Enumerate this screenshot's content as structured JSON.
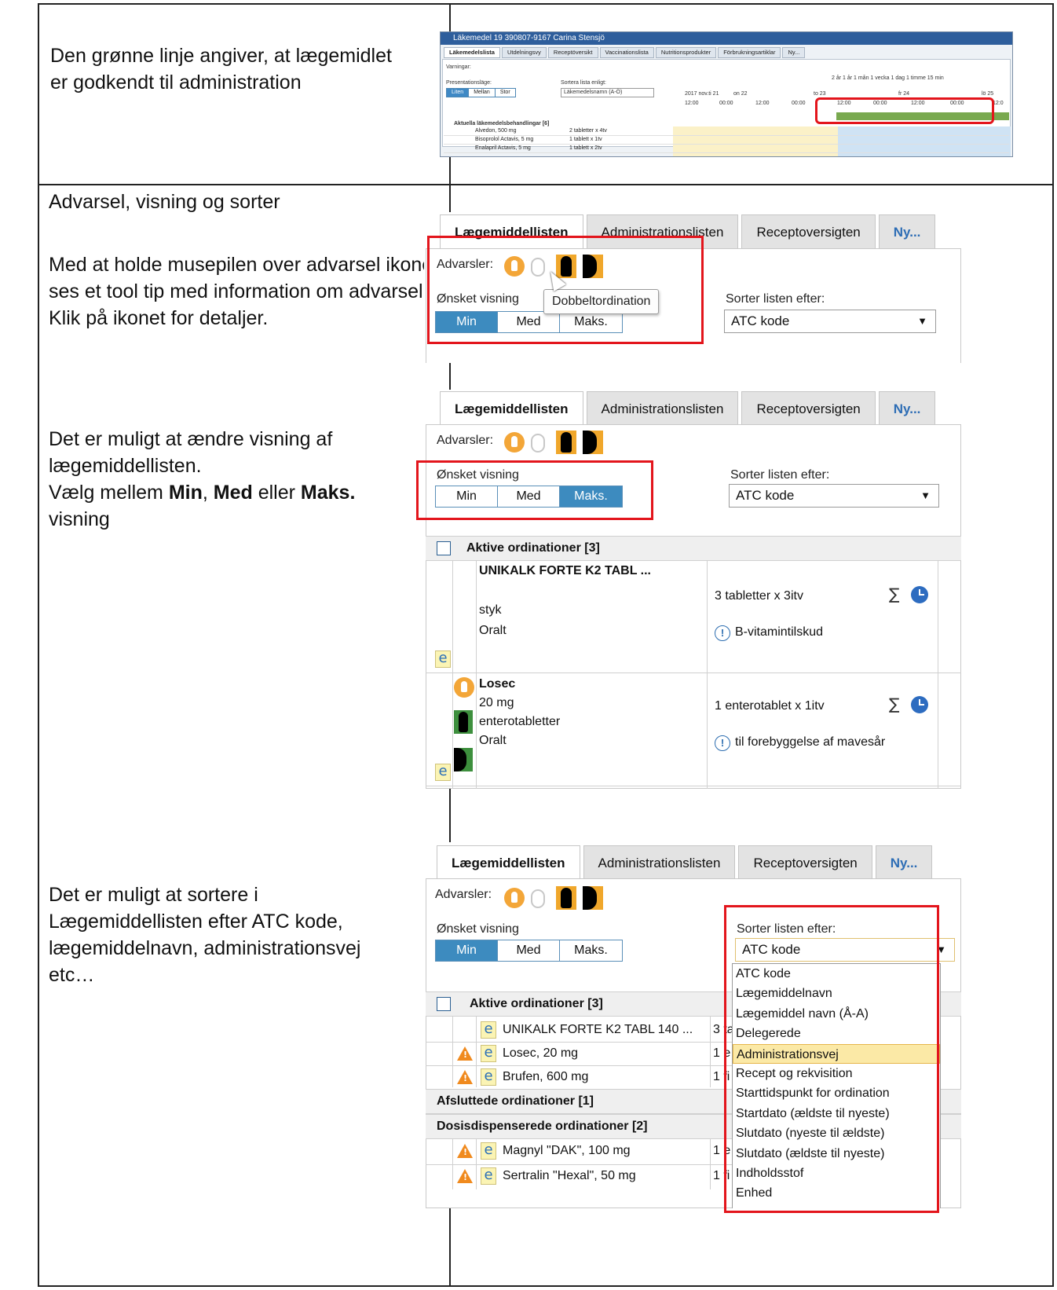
{
  "rows": [
    {
      "text": "Den grønne linje angiver, at lægemidlet er godkendt til administration"
    },
    {
      "heading": "Advarsel, visning og sorter",
      "text": "Med at holde musepilen over advarsel ikonet ses et tool tip med information om advarsel. Klik på ikonet for detaljer."
    },
    {
      "text_1": "Det er muligt at ændre visning af lægemiddellisten.",
      "text_2_pre": "Vælg mellem ",
      "opt_min": "Min",
      "sep1": ", ",
      "opt_med": "Med",
      "sep2": " eller ",
      "opt_maks": "Maks.",
      "text_2_post": "visning"
    },
    {
      "text": "Det er muligt at sortere i Lægemiddellisten efter ATC kode, lægemiddelnavn, administrationsvej etc…"
    }
  ],
  "overview": {
    "title": "Läkemedel 19 390807-9167 Carina Stensjö",
    "tabs": [
      "Läkemedelslista",
      "Utdelningsvy",
      "Receptöversikt",
      "Vaccinationslista",
      "Nutritionsprodukter",
      "Förbrukningsartiklar",
      "Ny..."
    ],
    "warnings_label": "Varningar:",
    "presentation_label": "Presentationsläge:",
    "presentation_options": [
      "Liten",
      "Mellan",
      "Stor"
    ],
    "sort_label": "Sortera lista enligt:",
    "sort_value": "Läkemedelsnamn (A-Ö)",
    "zoom_labels": "2 år   1 år   1 mån  1 vecka  1 dag  1 timme  15 min",
    "dates": [
      "2017 nov.ti 21",
      "on 22",
      "to 23",
      "fr 24",
      "lö 25"
    ],
    "times": [
      "12:00",
      "00:00",
      "12:00",
      "00:00",
      "12:00",
      "00:00",
      "12:00",
      "00:00",
      "12:0"
    ],
    "group": "Aktuella läkemedelsbehandlingar [6]",
    "rows": [
      {
        "name": "Alvedon, 500 mg",
        "dose": "2 tabletter x 4tv"
      },
      {
        "name": "Bisoprolol Actavis, 5 mg",
        "dose": "1 tablett x 1tv"
      },
      {
        "name": "Enalapril Actavis, 5 mg",
        "dose": "1 tablett x 2tv"
      }
    ]
  },
  "tabs": [
    "Lægemiddellisten",
    "Administrationslisten",
    "Receptoversigten",
    "Ny..."
  ],
  "warnings_label": "Advarsler:",
  "view_label": "Ønsket visning",
  "view_options": [
    "Min",
    "Med",
    "Maks."
  ],
  "view_options_s2": [
    "Min",
    "Med",
    "Maks."
  ],
  "sort_label": "Sorter listen efter:",
  "sort_value": "ATC kode",
  "tooltip": "Dobbeltordination",
  "s3": {
    "group": "Aktive ordinationer [3]",
    "items": [
      {
        "name": "UNIKALK FORTE K2 TABL ...",
        "unit": "styk",
        "route": "Oralt",
        "dose": "3 tabletter x 3itv",
        "note": "B-vitamintilskud"
      },
      {
        "name": "Losec",
        "strength": "20 mg",
        "form": "enterotabletter",
        "route": "Oralt",
        "dose": "1 enterotablet x 1itv",
        "note": "til forebyggelse af mavesår"
      }
    ]
  },
  "s4": {
    "group_active": "Aktive ordinationer [3]",
    "active_items": [
      "UNIKALK FORTE K2 TABL 140 ...",
      "Losec, 20 mg",
      "Brufen, 600 mg"
    ],
    "active_dose_frag": [
      "3 ta",
      "1 e",
      "1 fi"
    ],
    "group_finished": "Afsluttede ordinationer [1]",
    "group_dosis": "Dosisdispenserede ordinationer [2]",
    "dosis_items": [
      "Magnyl \"DAK\", 100 mg",
      "Sertralin \"Hexal\", 50 mg"
    ],
    "dosis_dose_frag": [
      "1 e",
      "1 fi"
    ],
    "menu": [
      "ATC kode",
      "Lægemiddelnavn",
      "Lægemiddel navn (Å-A)",
      "Delegerede",
      "Administrationsvej",
      "Recept og rekvisition",
      "Starttidspunkt for ordination",
      "Startdato (ældste til nyeste)",
      "Slutdato (nyeste til ældste)",
      "Slutdato (ældste til nyeste)",
      "Indholdsstof",
      "Enhed"
    ],
    "menu_highlighted": "Administrationsvej"
  },
  "colors": {
    "accent": "#3d8bbf",
    "highlight_box": "#e3151c",
    "approved_line": "#79a94f"
  }
}
